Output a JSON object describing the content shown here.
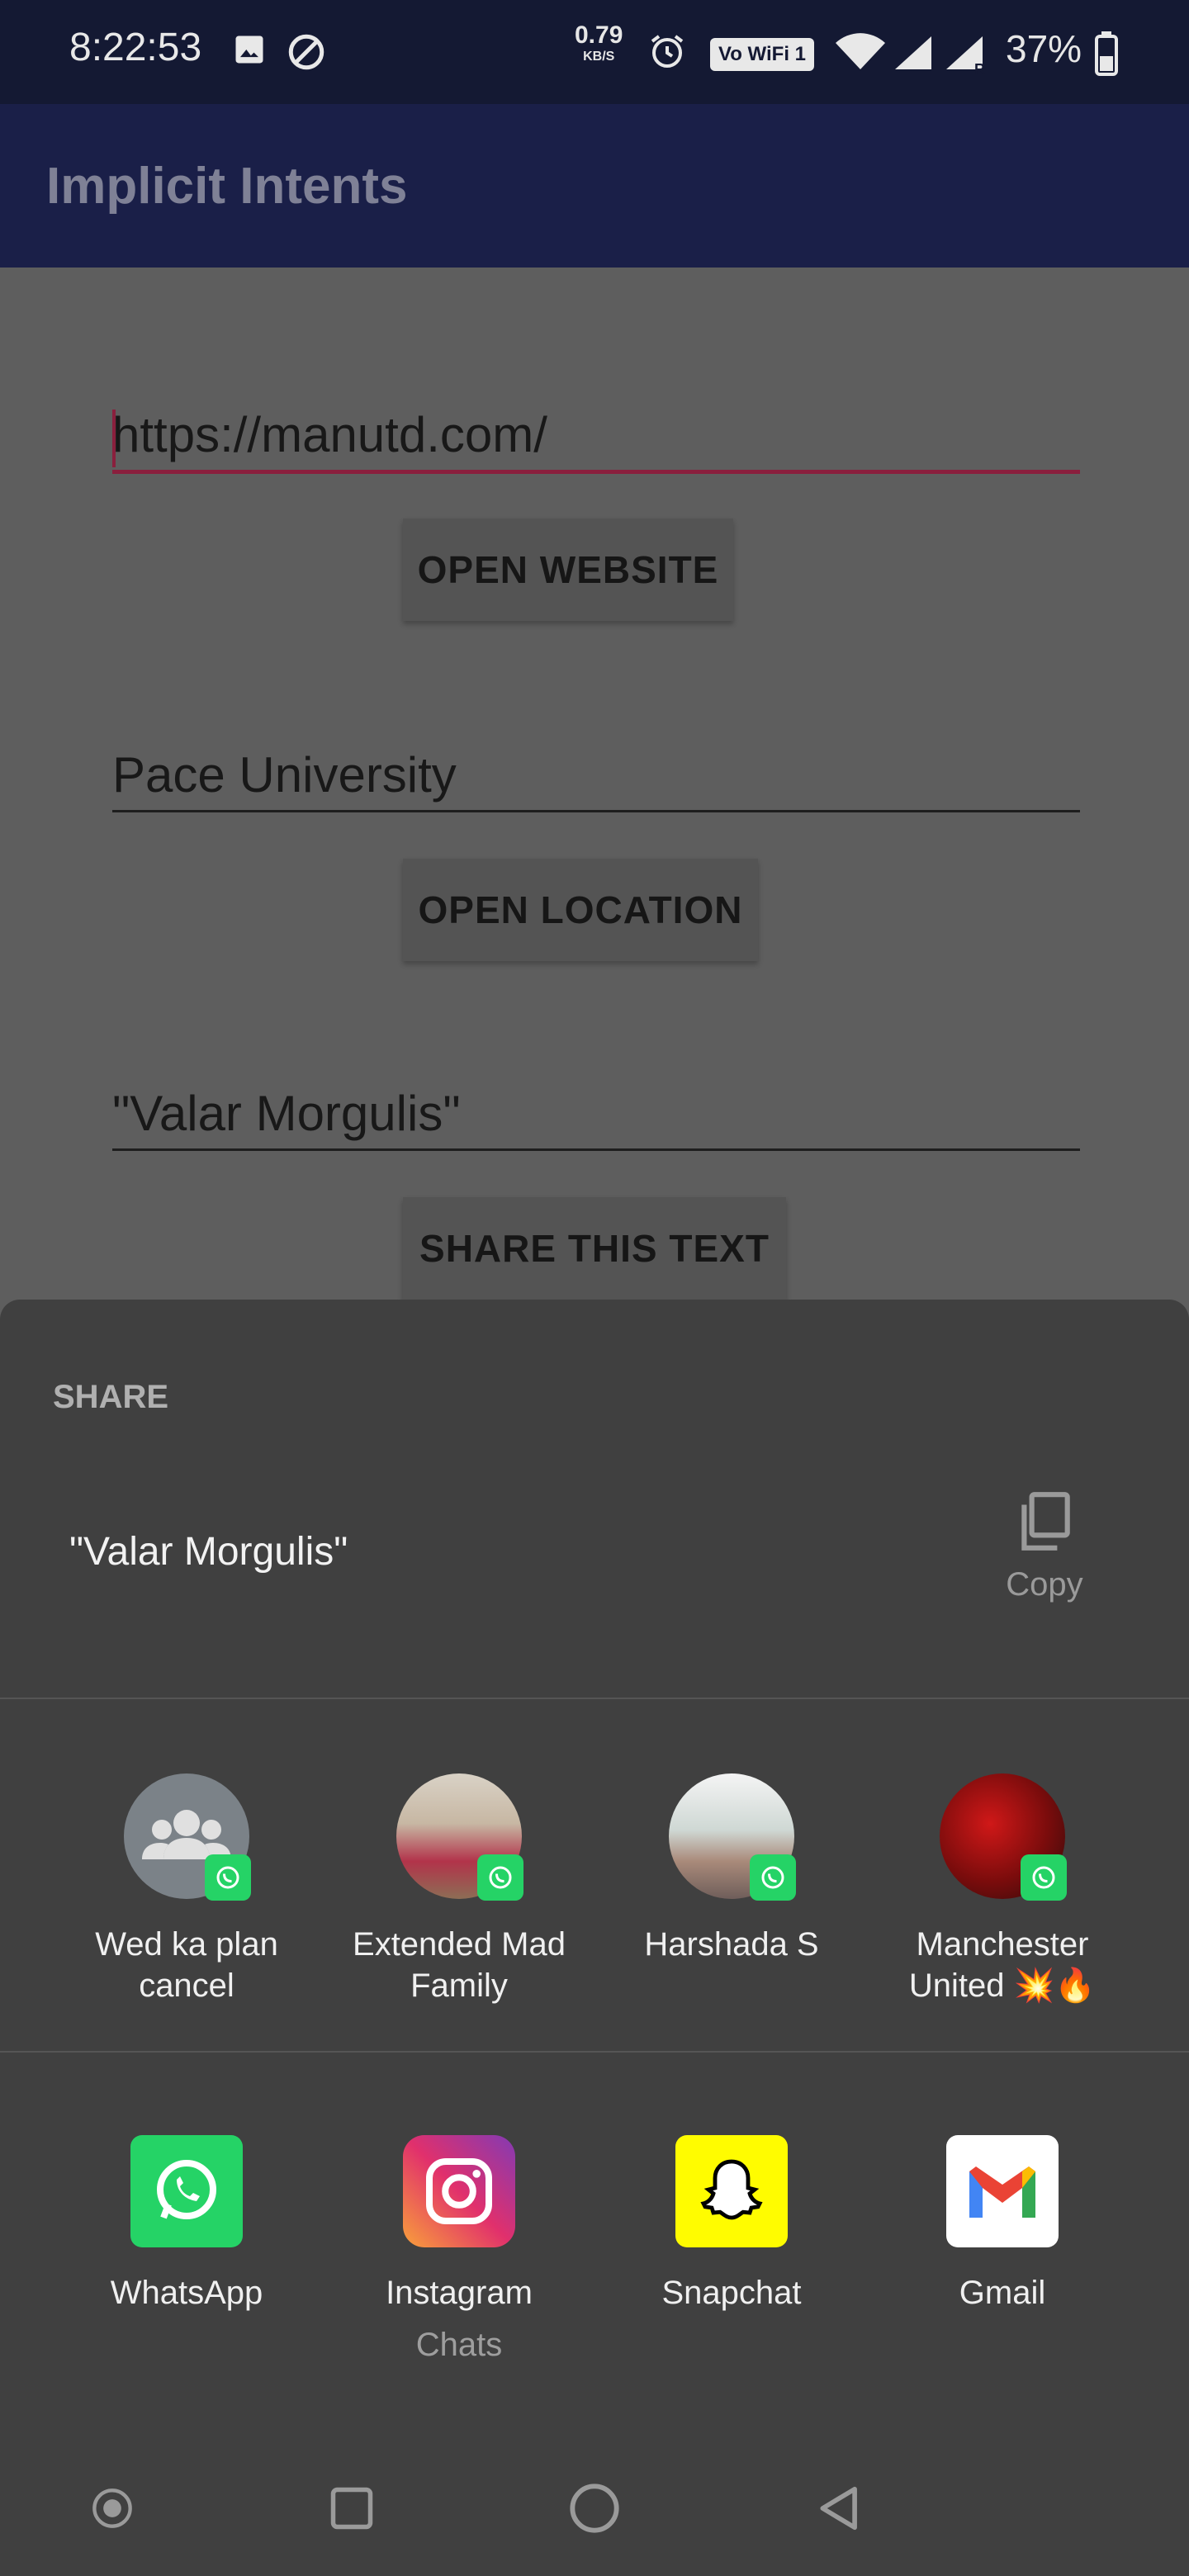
{
  "status_bar": {
    "time": "8:22:53",
    "net_speed": "0.79",
    "net_speed_unit": "KB/S",
    "wifi_badge": "Vo WiFi 1",
    "battery": "37%"
  },
  "app_bar": {
    "title": "Implicit Intents"
  },
  "form": {
    "url_value": "https://manutd.com/",
    "open_website_label": "OPEN WEBSITE",
    "location_value": "Pace University",
    "open_location_label": "OPEN LOCATION",
    "share_text_value": "\"Valar Morgulis\"",
    "share_text_label": "SHARE THIS TEXT"
  },
  "share_sheet": {
    "title": "SHARE",
    "preview_text": "\"Valar Morgulis\"",
    "copy_label": "Copy",
    "direct_targets": [
      {
        "name_line1": "Wed ka plan",
        "name_line2": "cancel"
      },
      {
        "name_line1": "Extended Mad",
        "name_line2": "Family"
      },
      {
        "name_line1": "Harshada S",
        "name_line2": ""
      },
      {
        "name_line1": "Manchester",
        "name_line2": "United 💥🔥"
      }
    ],
    "apps": [
      {
        "name": "WhatsApp",
        "sub": "",
        "icon": "whatsapp-icon",
        "color": "#25d366"
      },
      {
        "name": "Instagram",
        "sub": "Chats",
        "icon": "instagram-icon",
        "color": "#e1306c"
      },
      {
        "name": "Snapchat",
        "sub": "",
        "icon": "snapchat-icon",
        "color": "#fffc00"
      },
      {
        "name": "Gmail",
        "sub": "",
        "icon": "gmail-icon",
        "color": "#ffffff"
      }
    ]
  },
  "colors": {
    "status_bar_bg": "#141933",
    "app_bar_bg": "#1a1f48",
    "accent": "#8a1f3d",
    "sheet_bg": "#404040"
  }
}
